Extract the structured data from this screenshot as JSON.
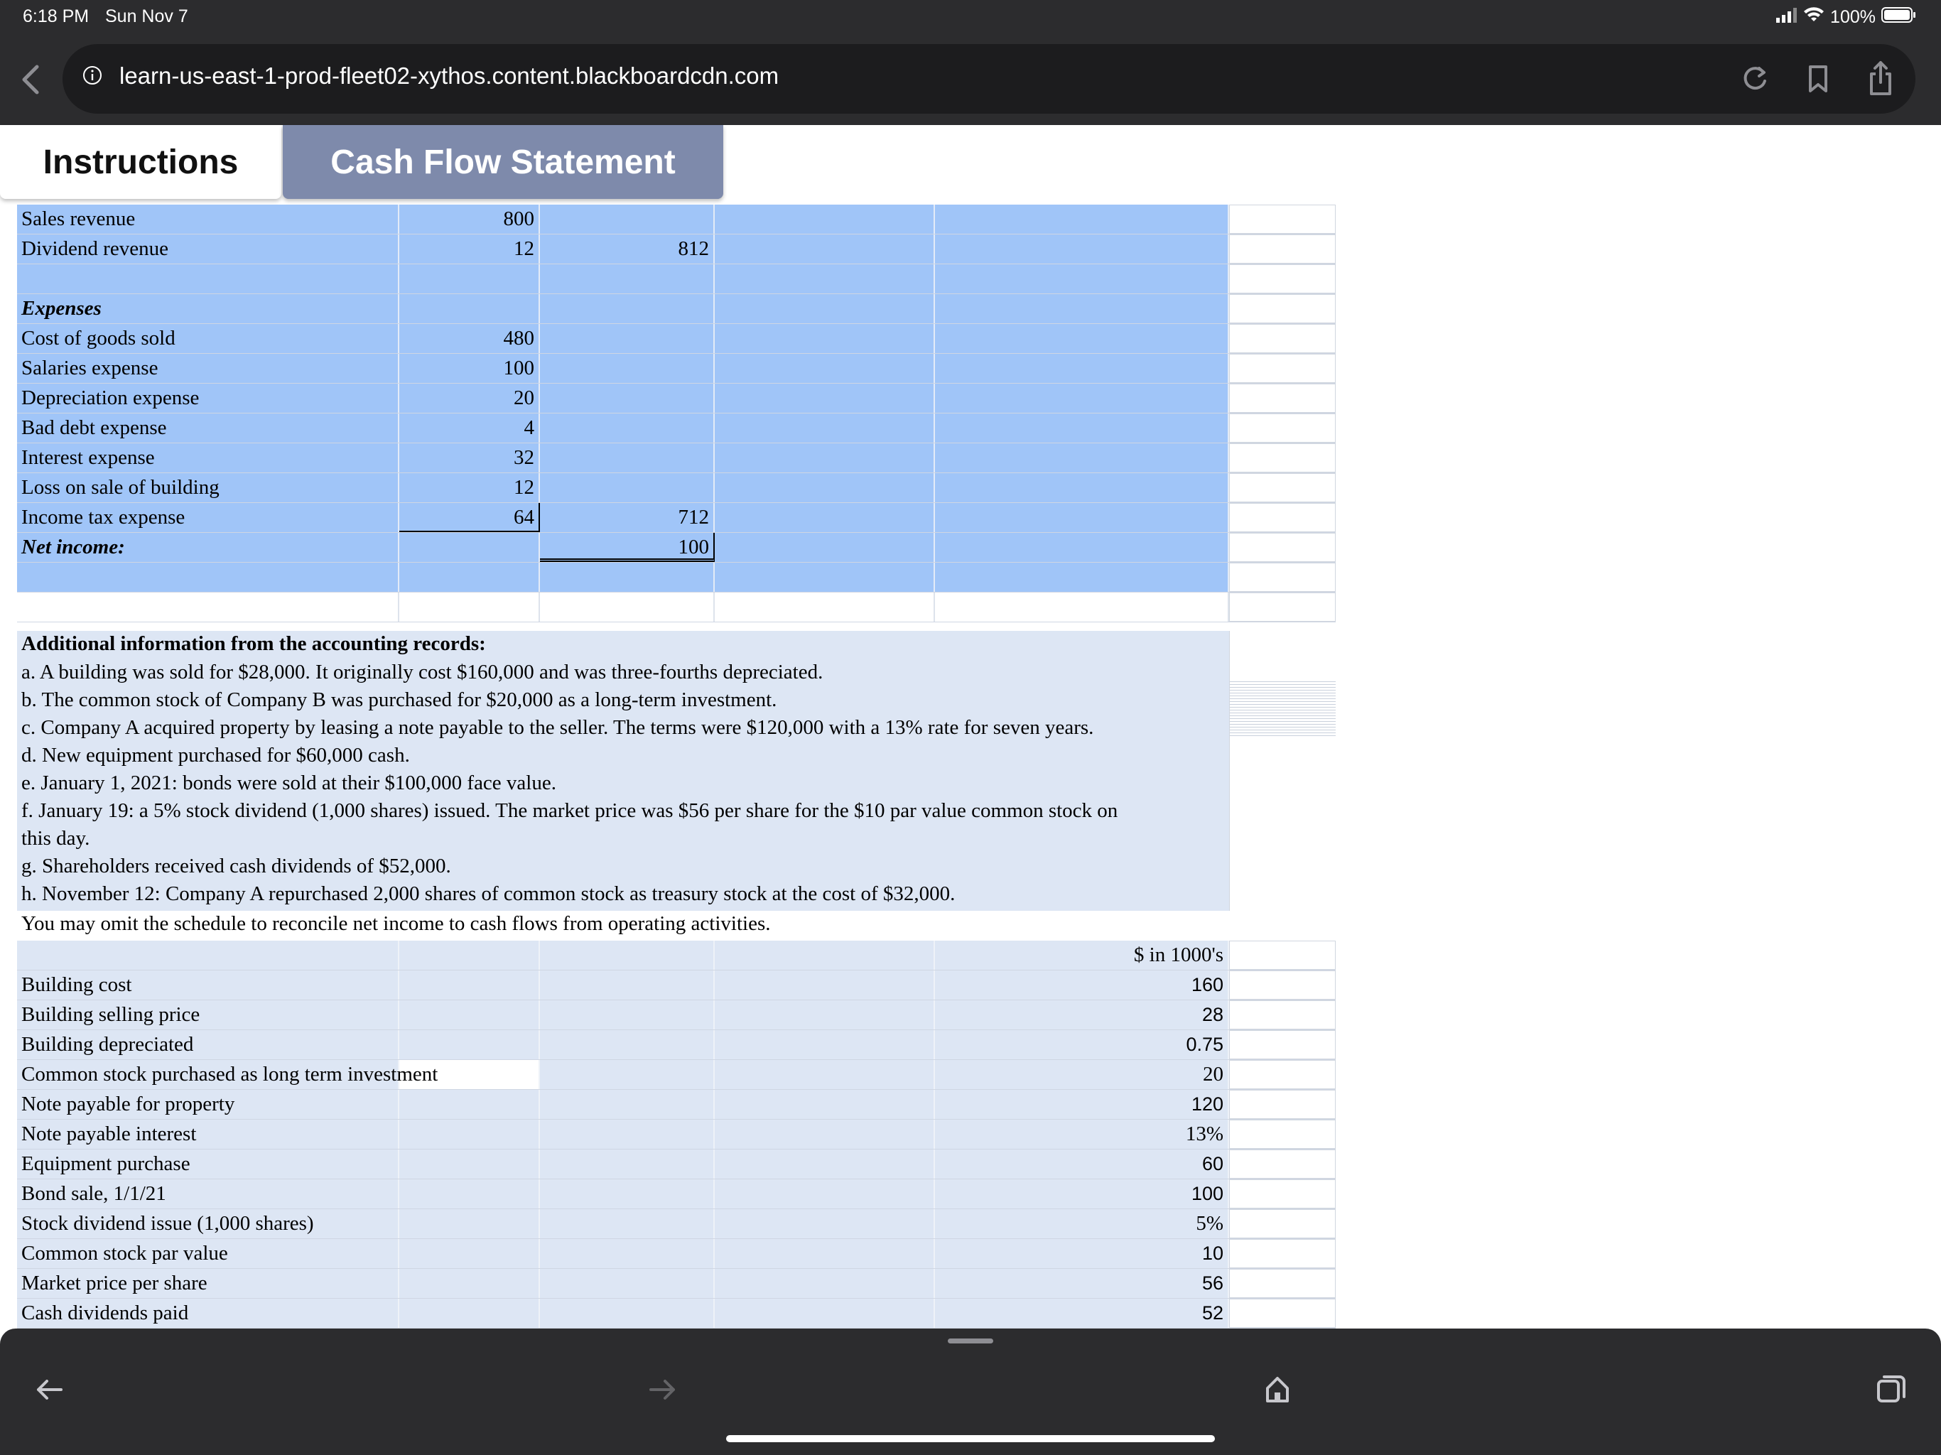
{
  "status_bar": {
    "time": "6:18 PM",
    "date": "Sun Nov 7",
    "battery": "100%"
  },
  "browser": {
    "url": "learn-us-east-1-prod-fleet02-xythos.content.blackboardcdn.com"
  },
  "tabs": [
    {
      "label": "Instructions",
      "active": true
    },
    {
      "label": "Cash Flow Statement",
      "active": false
    }
  ],
  "income": {
    "sales_revenue": {
      "label": "Sales revenue",
      "value": "800"
    },
    "dividend_revenue": {
      "label": "Dividend revenue",
      "value": "12",
      "total": "812"
    },
    "expenses_heading": "Expenses",
    "expenses": [
      {
        "label": "Cost of goods sold",
        "value": "480"
      },
      {
        "label": "Salaries expense",
        "value": "100"
      },
      {
        "label": "Depreciation expense",
        "value": "20"
      },
      {
        "label": "Bad debt expense",
        "value": "4"
      },
      {
        "label": "Interest expense",
        "value": "32"
      },
      {
        "label": "Loss on sale of building",
        "value": "12"
      },
      {
        "label": "Income tax expense",
        "value": "64",
        "total": "712"
      }
    ],
    "net_income": {
      "label": "Net income:",
      "value": "100"
    }
  },
  "additional": {
    "heading": "Additional information from the accounting records:",
    "lines": [
      "a.  A building was sold for $28,000. It originally cost $160,000 and was three-fourths depreciated.",
      "b.  The common stock of Company B was purchased for $20,000 as a long-term investment.",
      "c.  Company A acquired property by leasing a note payable to the seller. The terms were $120,000 with a 13% rate for seven years.",
      "d.  New equipment purchased for $60,000 cash.",
      "e.  January 1, 2021: bonds were sold at their $100,000 face value.",
      "f.  January 19: a 5% stock dividend (1,000 shares) issued.  The market price was $56 per share for the $10 par value common stock on",
      "this day.",
      "g.  Shareholders received cash dividends of $52,000.",
      "h.  November 12: Company A repurchased 2,000 shares of common stock as treasury stock at the cost of $32,000.",
      "You may omit the schedule to reconcile net income to cash flows from operating activities."
    ]
  },
  "data_table": {
    "unit_header": "$ in 1000's",
    "rows": [
      {
        "label": "Building cost",
        "value": "160"
      },
      {
        "label": "Building selling price",
        "value": "28"
      },
      {
        "label": "Building depreciated",
        "value": "0.75"
      },
      {
        "label": "Common stock purchased as long term investment",
        "value": "20"
      },
      {
        "label": "Note payable for property",
        "value": "120"
      },
      {
        "label": "Note payable interest",
        "value": "13%"
      },
      {
        "label": "Equipment purchase",
        "value": "60"
      },
      {
        "label": "Bond sale, 1/1/21",
        "value": "100"
      },
      {
        "label": "Stock dividend issue (1,000 shares)",
        "value": "5%"
      },
      {
        "label": "Common stock par value",
        "value": "10"
      },
      {
        "label": "Market price per share",
        "value": "56"
      },
      {
        "label": "Cash dividends paid",
        "value": "52"
      }
    ]
  },
  "colors": {
    "bar_bg": "#2c2c2e",
    "blue_cell": "#a0c5f8",
    "pale_cell": "#dde6f4",
    "tab_inactive": "#7e8aab"
  }
}
